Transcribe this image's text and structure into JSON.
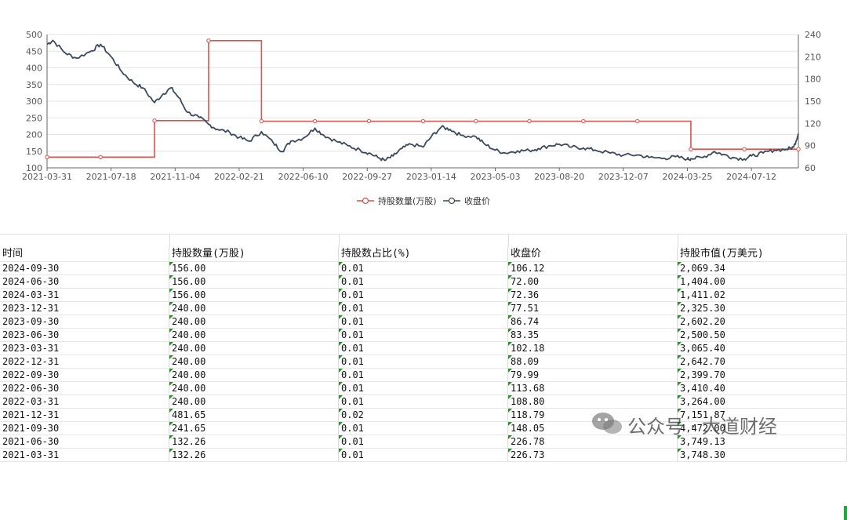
{
  "chart_data": {
    "type": "line",
    "x_ticks": [
      "2021-03-31",
      "2021-07-18",
      "2021-11-04",
      "2022-02-21",
      "2022-06-10",
      "2022-09-27",
      "2023-01-14",
      "2023-05-03",
      "2023-08-20",
      "2023-12-07",
      "2024-03-25",
      "2024-07-12"
    ],
    "y_left_ticks": [
      "500",
      "450",
      "400",
      "350",
      "300",
      "250",
      "200",
      "150",
      "100"
    ],
    "y_right_ticks": [
      "240",
      "210",
      "180",
      "150",
      "120",
      "90",
      "60"
    ],
    "y_left_range": [
      100,
      500
    ],
    "y_right_range": [
      60,
      240
    ],
    "grid": true,
    "legend_position": "bottom-center",
    "colors": {
      "holdings": "#d9534f",
      "price": "#3a4a5c"
    },
    "series": [
      {
        "name": "持股数量(万股)",
        "axis": "left",
        "step": true,
        "points": [
          [
            "2021-03-31",
            132.26
          ],
          [
            "2021-06-30",
            132.26
          ],
          [
            "2021-09-30",
            241.65
          ],
          [
            "2021-12-31",
            481.65
          ],
          [
            "2022-03-31",
            240
          ],
          [
            "2022-06-30",
            240
          ],
          [
            "2022-09-30",
            240
          ],
          [
            "2022-12-31",
            240
          ],
          [
            "2023-03-31",
            240
          ],
          [
            "2023-06-30",
            240
          ],
          [
            "2023-09-30",
            240
          ],
          [
            "2023-12-31",
            240
          ],
          [
            "2024-03-31",
            156
          ],
          [
            "2024-06-30",
            156
          ],
          [
            "2024-09-30",
            156
          ]
        ]
      },
      {
        "name": "收盘价",
        "axis": "right",
        "points": [
          [
            "2021-03-31",
            226.73
          ],
          [
            "2021-04-10",
            232
          ],
          [
            "2021-05-01",
            215
          ],
          [
            "2021-05-20",
            208
          ],
          [
            "2021-06-15",
            218
          ],
          [
            "2021-06-30",
            226.78
          ],
          [
            "2021-07-18",
            210
          ],
          [
            "2021-08-05",
            190
          ],
          [
            "2021-08-25",
            175
          ],
          [
            "2021-09-10",
            168
          ],
          [
            "2021-09-30",
            148.05
          ],
          [
            "2021-10-15",
            160
          ],
          [
            "2021-10-28",
            168
          ],
          [
            "2021-11-10",
            155
          ],
          [
            "2021-11-25",
            135
          ],
          [
            "2021-12-15",
            128
          ],
          [
            "2021-12-31",
            118.79
          ],
          [
            "2022-01-15",
            112
          ],
          [
            "2022-02-05",
            108
          ],
          [
            "2022-02-21",
            101
          ],
          [
            "2022-03-10",
            96
          ],
          [
            "2022-03-31",
            108.8
          ],
          [
            "2022-04-20",
            94
          ],
          [
            "2022-05-05",
            82
          ],
          [
            "2022-05-20",
            96
          ],
          [
            "2022-06-10",
            100
          ],
          [
            "2022-06-30",
            113.68
          ],
          [
            "2022-07-15",
            104
          ],
          [
            "2022-08-05",
            96
          ],
          [
            "2022-08-25",
            90
          ],
          [
            "2022-09-15",
            84
          ],
          [
            "2022-09-30",
            79.99
          ],
          [
            "2022-10-15",
            74
          ],
          [
            "2022-10-27",
            70
          ],
          [
            "2022-11-10",
            76
          ],
          [
            "2022-11-25",
            86
          ],
          [
            "2022-12-10",
            92
          ],
          [
            "2022-12-31",
            88.09
          ],
          [
            "2023-01-14",
            102
          ],
          [
            "2023-01-31",
            115
          ],
          [
            "2023-02-15",
            112
          ],
          [
            "2023-03-05",
            104
          ],
          [
            "2023-03-31",
            102.18
          ],
          [
            "2023-04-15",
            92
          ],
          [
            "2023-05-03",
            84
          ],
          [
            "2023-05-20",
            80
          ],
          [
            "2023-06-10",
            83
          ],
          [
            "2023-06-30",
            83.35
          ],
          [
            "2023-07-15",
            86
          ],
          [
            "2023-08-05",
            90
          ],
          [
            "2023-08-20",
            92
          ],
          [
            "2023-09-10",
            88
          ],
          [
            "2023-09-30",
            86.74
          ],
          [
            "2023-10-20",
            84
          ],
          [
            "2023-11-15",
            80
          ],
          [
            "2023-12-07",
            77
          ],
          [
            "2023-12-31",
            77.51
          ],
          [
            "2024-01-20",
            74
          ],
          [
            "2024-02-15",
            73
          ],
          [
            "2024-03-05",
            75
          ],
          [
            "2024-03-25",
            72
          ],
          [
            "2024-03-31",
            72.36
          ],
          [
            "2024-04-20",
            74
          ],
          [
            "2024-05-10",
            82
          ],
          [
            "2024-05-25",
            78
          ],
          [
            "2024-06-10",
            74
          ],
          [
            "2024-06-30",
            72
          ],
          [
            "2024-07-12",
            76
          ],
          [
            "2024-08-01",
            80
          ],
          [
            "2024-08-20",
            84
          ],
          [
            "2024-09-10",
            85
          ],
          [
            "2024-09-22",
            88
          ],
          [
            "2024-09-30",
            106.12
          ]
        ]
      }
    ]
  },
  "table": {
    "headers": [
      "时间",
      "持股数量(万股)",
      "持股数占比(%)",
      "收盘价",
      "持股市值(万美元)"
    ],
    "rows": [
      [
        "2024-09-30",
        "156.00",
        "0.01",
        "106.12",
        "2,069.34"
      ],
      [
        "2024-06-30",
        "156.00",
        "0.01",
        "72.00",
        "1,404.00"
      ],
      [
        "2024-03-31",
        "156.00",
        "0.01",
        "72.36",
        "1,411.02"
      ],
      [
        "2023-12-31",
        "240.00",
        "0.01",
        "77.51",
        "2,325.30"
      ],
      [
        "2023-09-30",
        "240.00",
        "0.01",
        "86.74",
        "2,602.20"
      ],
      [
        "2023-06-30",
        "240.00",
        "0.01",
        "83.35",
        "2,500.50"
      ],
      [
        "2023-03-31",
        "240.00",
        "0.01",
        "102.18",
        "3,065.40"
      ],
      [
        "2022-12-31",
        "240.00",
        "0.01",
        "88.09",
        "2,642.70"
      ],
      [
        "2022-09-30",
        "240.00",
        "0.01",
        "79.99",
        "2,399.70"
      ],
      [
        "2022-06-30",
        "240.00",
        "0.01",
        "113.68",
        "3,410.40"
      ],
      [
        "2022-03-31",
        "240.00",
        "0.01",
        "108.80",
        "3,264.00"
      ],
      [
        "2021-12-31",
        "481.65",
        "0.02",
        "118.79",
        "7,151.87"
      ],
      [
        "2021-09-30",
        "241.65",
        "0.01",
        "148.05",
        "4,472.00"
      ],
      [
        "2021-06-30",
        "132.26",
        "0.01",
        "226.78",
        "3,749.13"
      ],
      [
        "2021-03-31",
        "132.26",
        "0.01",
        "226.73",
        "3,748.30"
      ]
    ]
  },
  "watermark": {
    "text": "公众号 · 大道财经",
    "icon": "wechat-icon"
  }
}
